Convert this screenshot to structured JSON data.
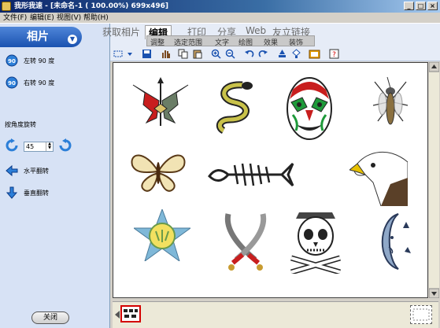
{
  "window": {
    "title": "我形我速 - [未命名-1 ( 100.00%) 699x496]",
    "minimize_label": "_",
    "maximize_label": "□",
    "close_label": "×"
  },
  "menu": [
    "文件(F)",
    "编辑(E)",
    "视图(V)",
    "帮助(H)"
  ],
  "left_panel": {
    "header": "相片",
    "rotate_left": "左转 90 度",
    "rotate_right": "右转 90 度",
    "rotate_angle_label": "按角度旋转",
    "angle_value": "45",
    "flip_horizontal": "水平翻转",
    "flip_vertical": "垂直翻转",
    "rotate_icon_text": "90",
    "close_button": "关闭"
  },
  "tabs": [
    "获取相片",
    "编辑",
    "打印",
    "分享",
    "Web",
    "友立链接"
  ],
  "subtabs": [
    "调整",
    "选定范围",
    "文字",
    "绘图",
    "效果",
    "装饰"
  ],
  "toolbar_icons": [
    "select-icon",
    "save-icon",
    "pan-icon",
    "copy-icon",
    "paste-icon",
    "zoom-in-icon",
    "zoom-out-icon",
    "undo-icon",
    "redo-icon",
    "stamp-icon",
    "fill-icon",
    "frame-icon",
    "help-icon"
  ],
  "canvas_images": [
    "dragons",
    "snake",
    "opera-mask",
    "mosquito",
    "butterfly",
    "fish-bone",
    "eagle",
    "star-emblem",
    "crossed-swords",
    "skull-crossbones",
    "moon-face"
  ],
  "colors": {
    "accent": "#1a52b0",
    "titlebar": "#0a246a",
    "panel": "#d7e2f5"
  }
}
